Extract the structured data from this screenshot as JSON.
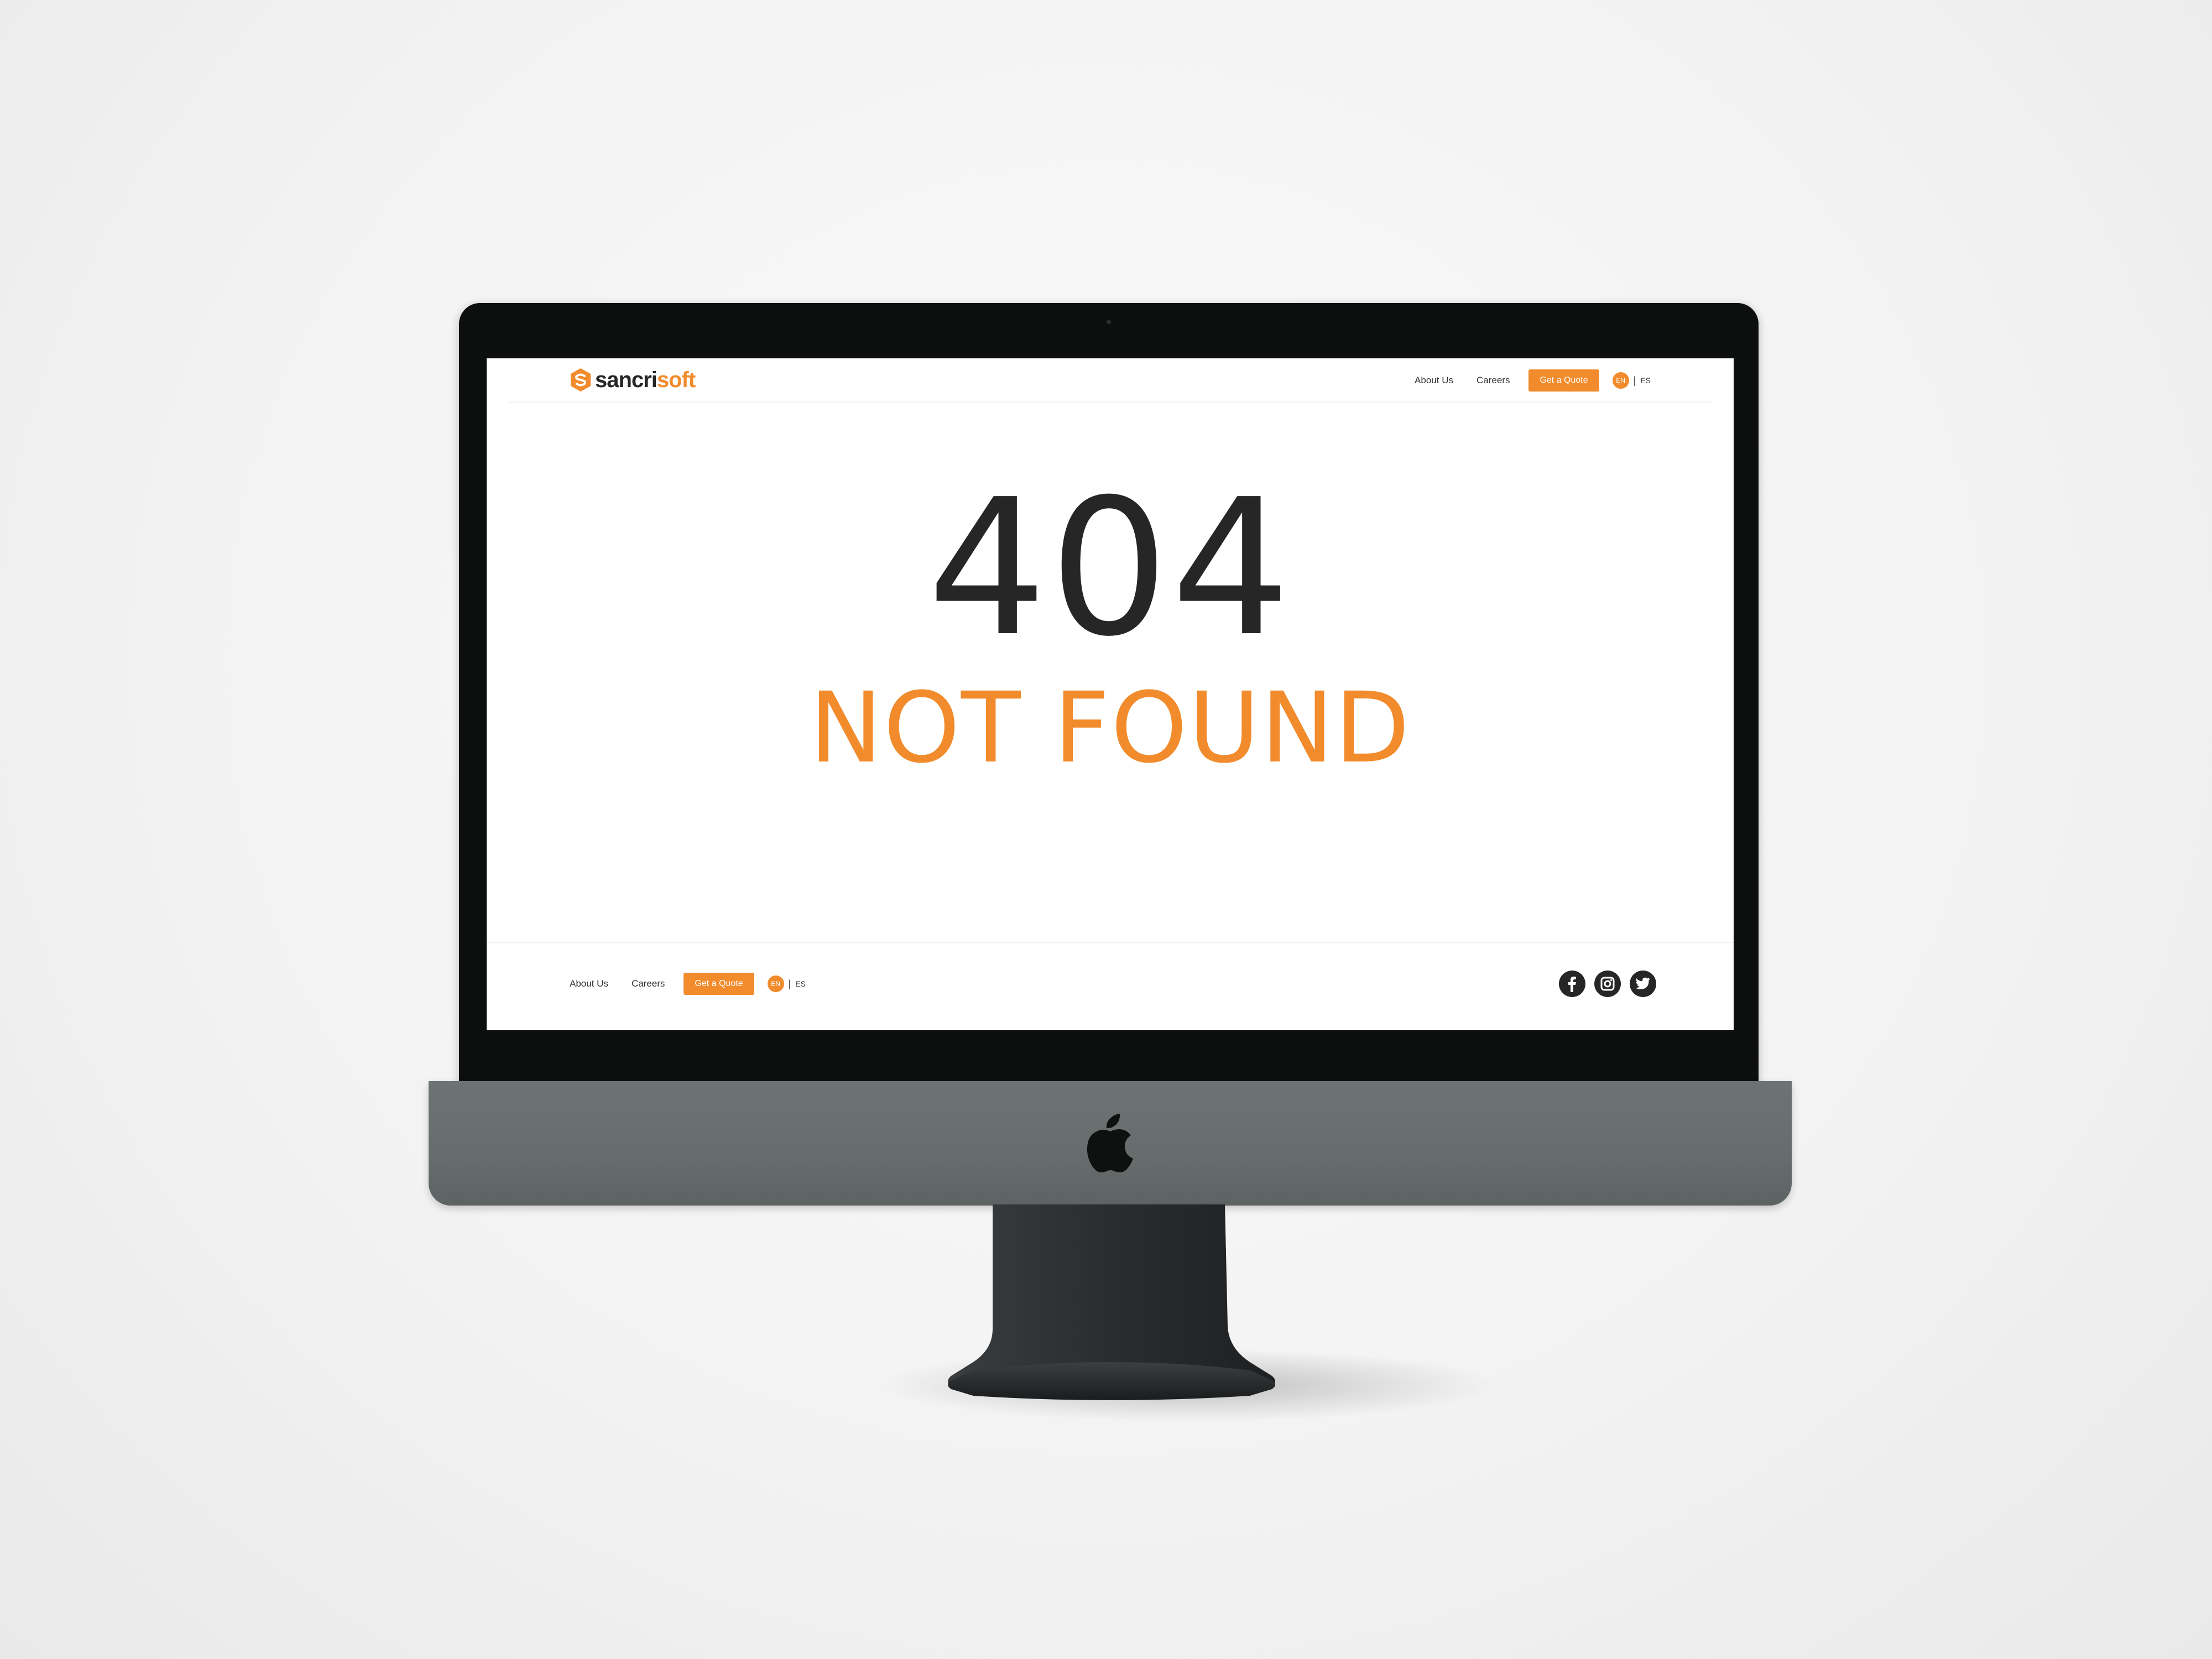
{
  "brand": {
    "name_dark": "sancri",
    "name_accent": "soft",
    "accent_color": "#f18b2c",
    "text_color": "#262626"
  },
  "header": {
    "nav": {
      "about": "About Us",
      "careers": "Careers",
      "quote": "Get a Quote"
    },
    "lang": {
      "active": "EN",
      "separator": "|",
      "other": "ES"
    }
  },
  "error": {
    "code": "404",
    "message": "NOT FOUND"
  },
  "footer": {
    "nav": {
      "about": "About Us",
      "careers": "Careers",
      "quote": "Get a Quote"
    },
    "lang": {
      "active": "EN",
      "separator": "|",
      "other": "ES"
    },
    "social": [
      "facebook-icon",
      "instagram-icon",
      "twitter-icon"
    ]
  },
  "device": {
    "logo": "apple-logo"
  }
}
